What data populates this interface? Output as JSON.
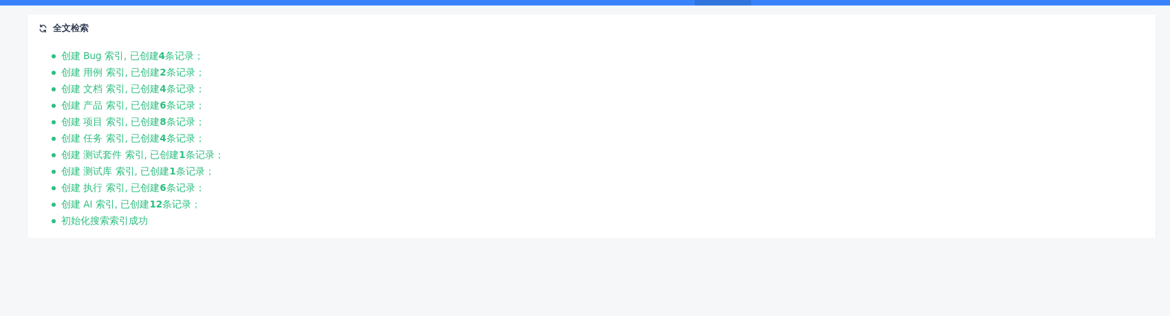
{
  "panel": {
    "title": "全文检索",
    "messages": [
      {
        "text": "创建 Bug 索引, 已创建**4**条记录；"
      },
      {
        "text": "创建 用例 索引, 已创建**2**条记录；"
      },
      {
        "text": "创建 文档 索引, 已创建**4**条记录；"
      },
      {
        "text": "创建 产品 索引, 已创建**6**条记录；"
      },
      {
        "text": "创建 项目 索引, 已创建**8**条记录；"
      },
      {
        "text": "创建 任务 索引, 已创建**4**条记录；"
      },
      {
        "text": "创建 测试套件 索引, 已创建**1**条记录；"
      },
      {
        "text": "创建 测试库 索引, 已创建**1**条记录；"
      },
      {
        "text": "创建 执行 索引, 已创建**6**条记录；"
      },
      {
        "text": "创建 AI 索引, 已创建**12**条记录；"
      },
      {
        "text": "初始化搜索索引成功"
      }
    ]
  }
}
